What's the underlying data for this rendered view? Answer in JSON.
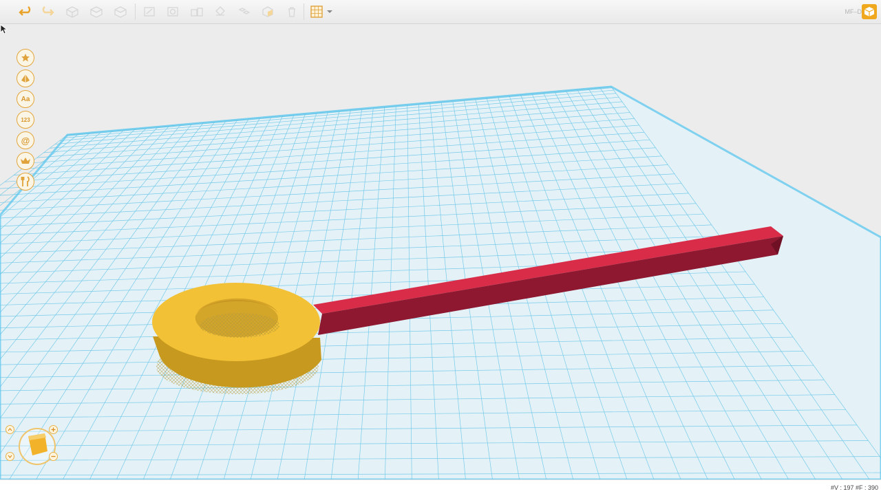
{
  "app": {
    "brand_label": "MF–D"
  },
  "toolbar": {
    "buttons": [
      {
        "name": "undo-button",
        "icon": "undo-icon",
        "active": true
      },
      {
        "name": "redo-button",
        "icon": "redo-icon",
        "active": false
      },
      {
        "name": "new-button",
        "icon": "cube-icon",
        "active": false
      },
      {
        "name": "open-button",
        "icon": "cube-icon",
        "active": false
      },
      {
        "name": "save-button",
        "icon": "cube-icon",
        "active": false
      },
      {
        "name": "transform-button",
        "icon": "transform-icon",
        "active": false
      },
      {
        "name": "rotate-button",
        "icon": "rotate-icon",
        "active": false
      },
      {
        "name": "scale-button",
        "icon": "scale-icon",
        "active": false
      },
      {
        "name": "mirror-button",
        "icon": "mirror-icon",
        "active": false
      },
      {
        "name": "group-button",
        "icon": "group-icon",
        "active": false
      },
      {
        "name": "ungroup-button",
        "icon": "ungroup-icon",
        "active": false
      },
      {
        "name": "delete-button",
        "icon": "trash-icon",
        "active": false
      },
      {
        "name": "grid-toggle-button",
        "icon": "grid-icon",
        "active": true
      }
    ]
  },
  "palette": {
    "items": [
      {
        "name": "palette-favorites",
        "icon": "star-icon",
        "label": ""
      },
      {
        "name": "palette-shapes",
        "icon": "pyramid-icon",
        "label": ""
      },
      {
        "name": "palette-text",
        "icon": "text-icon",
        "label": "Aa"
      },
      {
        "name": "palette-numbers",
        "icon": "numbers-icon",
        "label": "123"
      },
      {
        "name": "palette-symbols",
        "icon": "at-icon",
        "label": "@"
      },
      {
        "name": "palette-crowns",
        "icon": "crown-icon",
        "label": ""
      },
      {
        "name": "palette-tools",
        "icon": "utensils-icon",
        "label": ""
      }
    ]
  },
  "scene": {
    "ring_color": "#f2c136",
    "bar_color": "#c4243f",
    "grid_color": "#5fc4e8",
    "plate_color": "#e4f2f8"
  },
  "status": {
    "text": "#V : 197  #F : 390"
  }
}
